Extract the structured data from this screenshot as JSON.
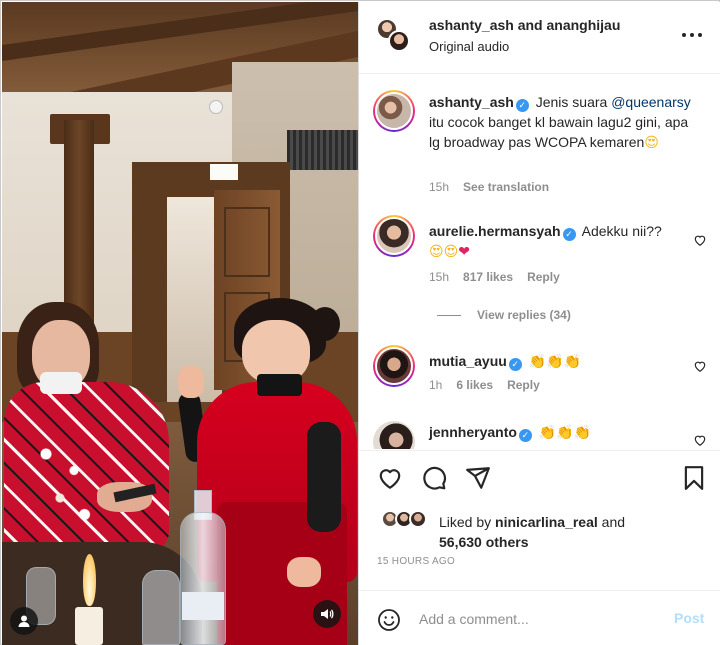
{
  "header": {
    "title": "ashanty_ash and ananghijau",
    "subtitle": "Original audio"
  },
  "caption": {
    "username": "ashanty_ash",
    "text_before": " Jenis suara ",
    "mention": "@queenarsy",
    "text_after": " itu cocok banget kl bawain lagu2 gini, apa lg broadway pas WCOPA kemaren",
    "emoji": "😍",
    "time": "15h",
    "see_translation": "See translation"
  },
  "comments": [
    {
      "username": "aurelie.hermansyah",
      "text": " Adekku nii??",
      "emoji_line": "😍😍",
      "heart": "❤",
      "time": "15h",
      "likes": "817 likes",
      "reply": "Reply",
      "view_replies": "View replies (34)"
    },
    {
      "username": "mutia_ayuu",
      "emoji": "👏👏👏",
      "time": "1h",
      "likes": "6 likes",
      "reply": "Reply"
    },
    {
      "username": "jennheryanto",
      "emoji": "👏👏👏"
    }
  ],
  "liked_by": {
    "prefix": "Liked by ",
    "user": "ninicarlina_real",
    "middle": " and",
    "count": "56,630 others"
  },
  "timestamp": "15 HOURS AGO",
  "add_comment": {
    "placeholder": "Add a comment...",
    "post_label": "Post"
  },
  "colors": {
    "verified": "#3897f0",
    "mention": "#00376b",
    "muted": "#8e8e8e",
    "post_disabled": "#b2dffc"
  }
}
